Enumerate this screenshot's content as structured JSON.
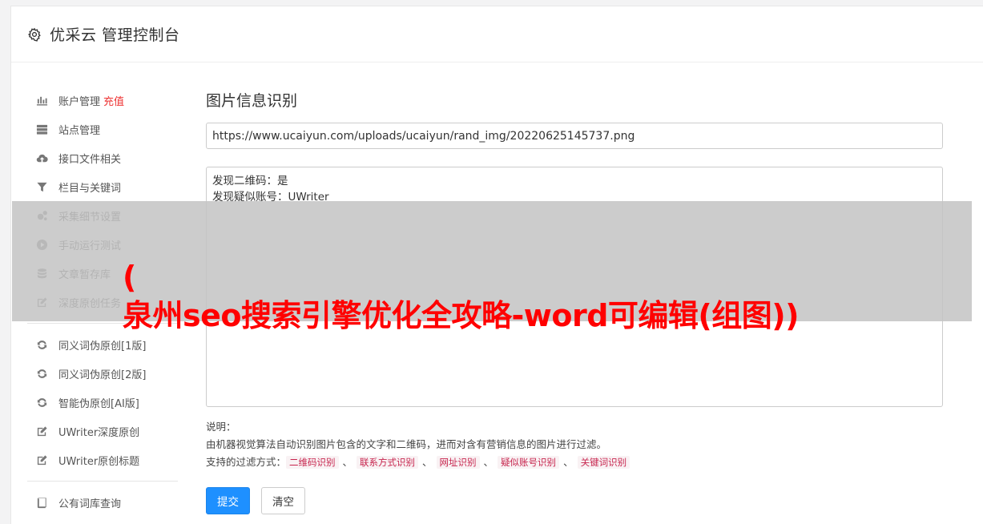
{
  "header": {
    "title": "优采云 管理控制台"
  },
  "sidebar": {
    "group1": [
      {
        "icon": "bar-chart-icon",
        "label": "账户管理",
        "extra": "充值"
      },
      {
        "icon": "server-icon",
        "label": "站点管理"
      },
      {
        "icon": "cloud-upload-icon",
        "label": "接口文件相关"
      },
      {
        "icon": "filter-icon",
        "label": "栏目与关键词"
      },
      {
        "icon": "cogs-icon",
        "label": "采集细节设置"
      },
      {
        "icon": "play-circle-icon",
        "label": "手动运行测试"
      },
      {
        "icon": "database-icon",
        "label": "文章暂存库"
      },
      {
        "icon": "edit-icon",
        "label": "深度原创任务"
      }
    ],
    "group2": [
      {
        "icon": "refresh-icon",
        "label": "同义词伪原创[1版]"
      },
      {
        "icon": "refresh-icon",
        "label": "同义词伪原创[2版]"
      },
      {
        "icon": "refresh-icon",
        "label": "智能伪原创[AI版]"
      },
      {
        "icon": "edit-icon",
        "label": "UWriter深度原创"
      },
      {
        "icon": "edit-icon",
        "label": "UWriter原创标题"
      }
    ],
    "group3": [
      {
        "icon": "book-icon",
        "label": "公有词库查询"
      }
    ]
  },
  "main": {
    "title": "图片信息识别",
    "url_value": "https://www.ucaiyun.com/uploads/ucaiyun/rand_img/20220625145737.png",
    "result_lines": [
      "发现二维码：是",
      "发现疑似账号：UWriter"
    ],
    "desc_label": "说明：",
    "desc_text": "由机器视觉算法自动识别图片包含的文字和二维码，进而对含有营销信息的图片进行过滤。",
    "filter_label": "支持的过滤方式：",
    "filter_tags": [
      "二维码识别",
      "联系方式识别",
      "网址识别",
      "疑似账号识别",
      "关键词识别"
    ],
    "filter_sep": "、",
    "submit_label": "提交",
    "clear_label": "清空"
  },
  "overlay": {
    "text": "(\n泉州seo搜索引擎优化全攻略-word可编辑(组图))"
  },
  "colors": {
    "primary": "#1e90ff",
    "recharge": "#ee3333",
    "tag_text": "#c7254e",
    "tag_bg": "#f9f2f4",
    "overlay_text": "#ff0000"
  }
}
